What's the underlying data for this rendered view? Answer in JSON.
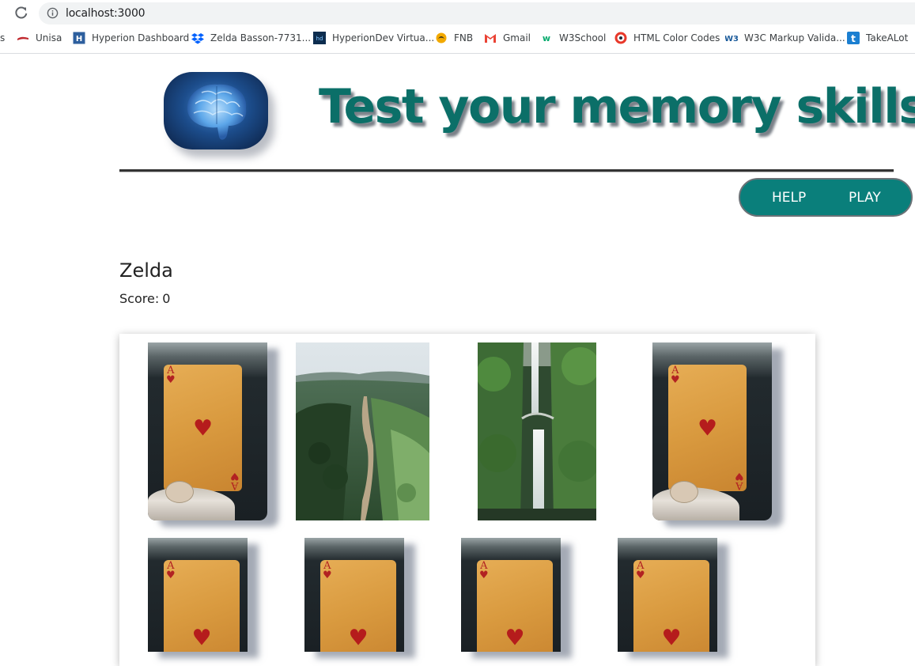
{
  "browser": {
    "url": "localhost:3000",
    "bookmarks": [
      {
        "label": "s",
        "icon": "bookmark-icon"
      },
      {
        "label": "Unisa",
        "icon": "unisa-icon"
      },
      {
        "label": "Hyperion Dashboard",
        "icon": "hyperion-icon"
      },
      {
        "label": "Zelda Basson-7731...",
        "icon": "dropbox-icon"
      },
      {
        "label": "HyperionDev Virtua...",
        "icon": "hyperiondev-icon"
      },
      {
        "label": "FNB",
        "icon": "fnb-icon"
      },
      {
        "label": "Gmail",
        "icon": "gmail-icon"
      },
      {
        "label": "W3School",
        "icon": "w3schools-icon"
      },
      {
        "label": "HTML Color Codes",
        "icon": "color-codes-icon"
      },
      {
        "label": "W3C Markup Valida...",
        "icon": "w3c-icon"
      },
      {
        "label": "TakeALot",
        "icon": "takealot-icon"
      }
    ]
  },
  "page": {
    "title": "Test your memory skills",
    "nav": {
      "help": "HELP",
      "play": "PLAY"
    },
    "player_name": "Zelda",
    "score_label": "Score:",
    "score_value": "0"
  },
  "cards": [
    {
      "state": "face-down"
    },
    {
      "state": "revealed",
      "image": "mountain-trail-photo"
    },
    {
      "state": "revealed",
      "image": "waterfall-photo"
    },
    {
      "state": "face-down"
    },
    {
      "state": "face-down"
    },
    {
      "state": "face-down"
    },
    {
      "state": "face-down"
    },
    {
      "state": "face-down"
    }
  ],
  "colors": {
    "accent": "#0a7f7b",
    "title": "#0b6f68",
    "card_red": "#b51c1c"
  }
}
